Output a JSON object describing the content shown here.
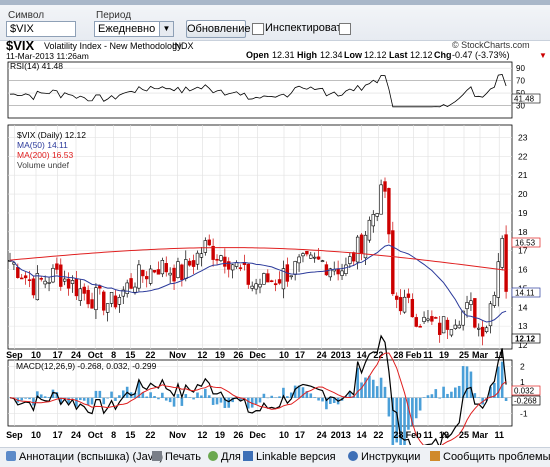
{
  "form": {
    "symbol_label": "Символ",
    "symbol_value": "$VIX",
    "period_label": "Период",
    "period_value": "Ежедневно",
    "update_button": "Обновление",
    "inspect_label": "Инспектировать"
  },
  "header": {
    "symbol": "$VIX",
    "name": "Volatility Index - New Methodology",
    "exchange": "INDX",
    "date": "11-Mar-2013 11:26am",
    "brand": "© StockCharts.com",
    "open_label": "Open",
    "open": "12.31",
    "high_label": "High",
    "high": "12.34",
    "low_label": "Low",
    "low": "12.12",
    "last_label": "Last",
    "last": "12.12",
    "chg_label": "Chg",
    "chg": "-0.47 (-3.73%)",
    "chg_marker": "▼"
  },
  "rsi": {
    "legend": "RSI(14) 41.48",
    "value_tag": "41.48",
    "ticks": [
      "90",
      "70",
      "50",
      "30"
    ]
  },
  "price": {
    "legend_main": "$VIX (Daily) 12.12",
    "legend_ma50": "MA(50) 14.11",
    "legend_ma200": "MA(200) 16.53",
    "legend_volume": "Volume undef",
    "tag_ma200": "16.53",
    "tag_ma50": "14.11",
    "tag_last": "12.12",
    "ticks": [
      "23",
      "22",
      "21",
      "20",
      "19",
      "18",
      "17",
      "16",
      "15",
      "14",
      "13",
      "12"
    ],
    "colors": {
      "up": "#000000",
      "down": "#cc0000",
      "ma50": "#2b3a9b",
      "ma200": "#e02020"
    }
  },
  "xaxis": {
    "labels": [
      "Sep",
      "10",
      "17",
      "24",
      "Oct",
      "8",
      "15",
      "22",
      "Nov",
      "12",
      "19",
      "26",
      "Dec",
      "10",
      "17",
      "24",
      "2013",
      "14",
      "22",
      "28",
      "Feb",
      "11",
      "19",
      "25",
      "Mar",
      "11"
    ]
  },
  "macd": {
    "legend": "MACD(12,26,9) -0.268, 0.032, -0.299",
    "tag1": "0.032",
    "tag2": "-0.268",
    "ticks": [
      "2",
      "1",
      "0",
      "-1"
    ]
  },
  "chart_data": {
    "type": "line",
    "title": "$VIX Volatility Index - New Methodology INDX",
    "price_series_approx": [
      {
        "label": "Sep",
        "value": 16.0
      },
      {
        "label": "Oct",
        "value": 15.3
      },
      {
        "label": "Nov",
        "value": 17.0
      },
      {
        "label": "Dec",
        "value": 15.6
      },
      {
        "label": "2013",
        "value": 14.5
      },
      {
        "label": "Feb",
        "value": 13.4
      },
      {
        "label": "Mar",
        "value": 12.12
      }
    ],
    "ma50_last": 14.11,
    "ma200_last": 16.53,
    "rsi_last": 41.48,
    "macd": {
      "macd": -0.268,
      "signal": 0.032,
      "histogram": -0.299
    },
    "ylim": [
      12,
      23
    ]
  },
  "footer": {
    "item1": "Аннотации (вспышка) (Java)",
    "item2": "Печать",
    "item3": "Для",
    "item4": "Linkable версия",
    "item5": "Инструкции",
    "item6": "Сообщить проблемы"
  }
}
